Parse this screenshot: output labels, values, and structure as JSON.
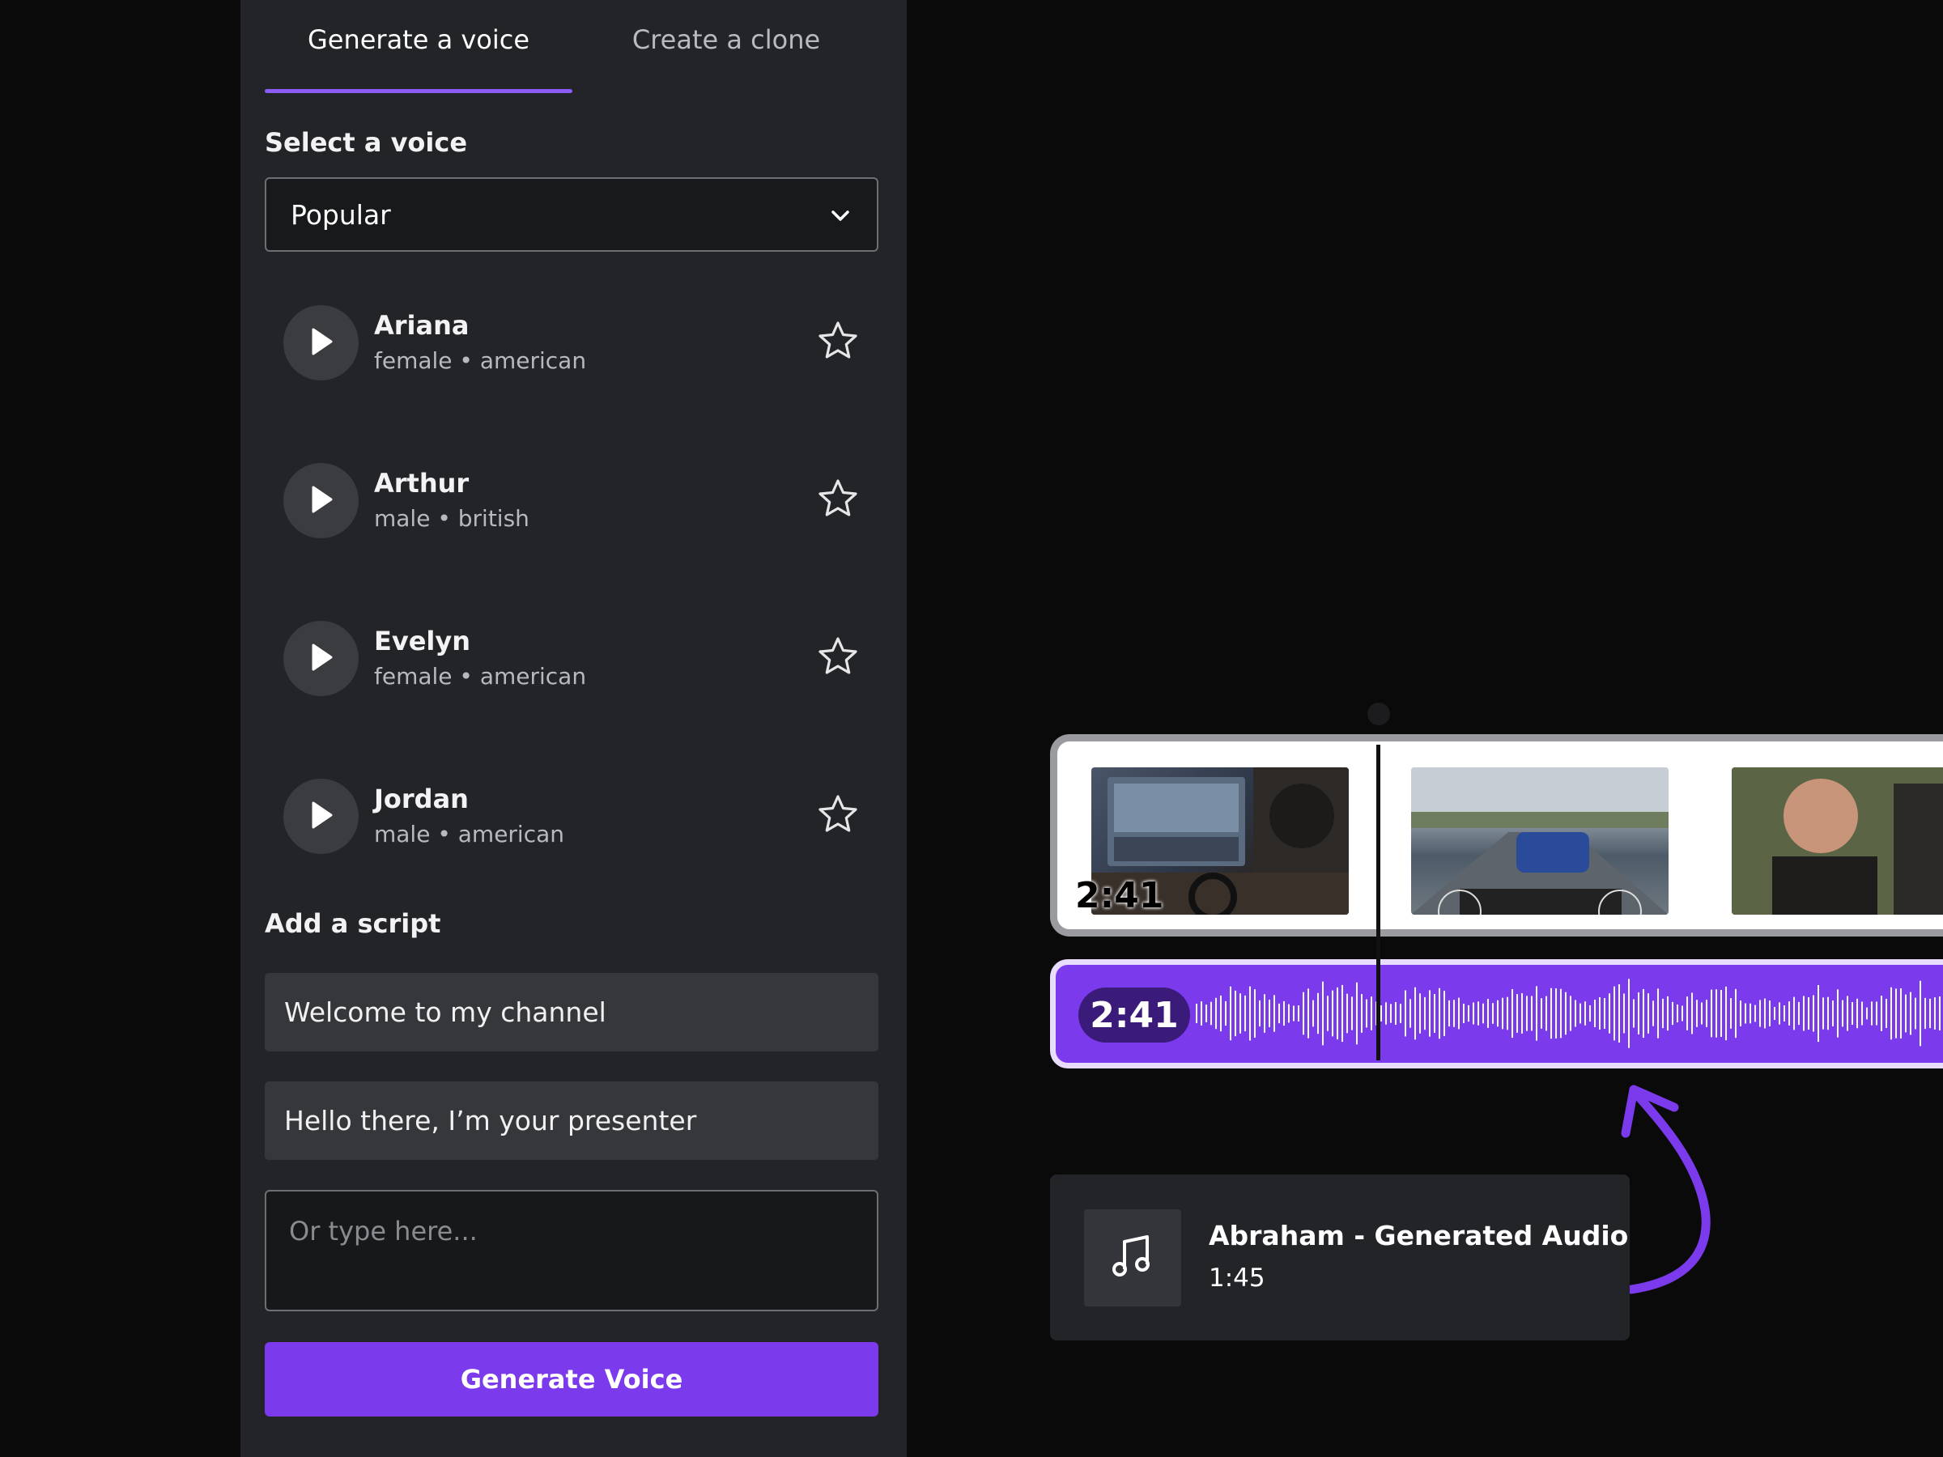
{
  "tabs": {
    "generate_label": "Generate a voice",
    "clone_label": "Create a clone"
  },
  "voice_section": {
    "label": "Select a voice",
    "dropdown_value": "Popular"
  },
  "voices": [
    {
      "name": "Ariana",
      "meta": "female • american"
    },
    {
      "name": "Arthur",
      "meta": "male • british"
    },
    {
      "name": "Evelyn",
      "meta": "female • american"
    },
    {
      "name": "Jordan",
      "meta": "male • american"
    }
  ],
  "script_section": {
    "label": "Add a script",
    "suggestions": [
      "Welcome to my channel",
      "Hello there, I’m your presenter"
    ],
    "input_placeholder": "Or type here...",
    "generate_button_label": "Generate Voice"
  },
  "timeline": {
    "video_time": "2:41",
    "audio_time": "2:41"
  },
  "audio_card": {
    "title": "Abraham - Generated Audio",
    "duration": "1:45"
  },
  "colors": {
    "accent": "#7c3aed",
    "panel_bg": "#232427",
    "page_bg": "#0a0a0b"
  },
  "icons": [
    "chevron-down-icon",
    "play-icon",
    "star-icon",
    "music-note-icon",
    "curved-arrow-icon"
  ]
}
